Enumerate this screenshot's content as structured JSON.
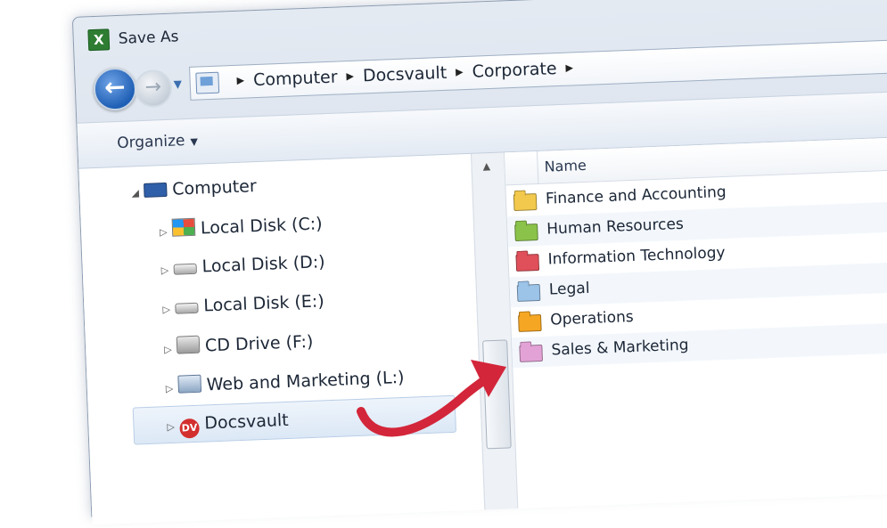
{
  "window": {
    "title": "Save As",
    "app_icon_letter": "X"
  },
  "address_bar": {
    "crumbs": [
      "Computer",
      "Docsvault",
      "Corporate"
    ]
  },
  "toolbar": {
    "organize_label": "Organize"
  },
  "navigation_pane": {
    "items": [
      {
        "label": "Computer",
        "icon": "computer-icon"
      },
      {
        "label": "Local Disk (C:)",
        "icon": "windows-drive-icon"
      },
      {
        "label": "Local Disk (D:)",
        "icon": "drive-icon"
      },
      {
        "label": "Local Disk (E:)",
        "icon": "drive-icon"
      },
      {
        "label": "CD Drive (F:)",
        "icon": "cd-drive-icon"
      },
      {
        "label": "Web and Marketing (L:)",
        "icon": "network-drive-icon"
      },
      {
        "label": "Docsvault",
        "icon": "docsvault-icon",
        "icon_text": "DV"
      }
    ]
  },
  "file_list": {
    "column_name": "Name",
    "folders": [
      {
        "label": "Finance and Accounting",
        "color": "#f2c94c"
      },
      {
        "label": "Human Resources",
        "color": "#8bc34a"
      },
      {
        "label": "Information Technology",
        "color": "#e0505a"
      },
      {
        "label": "Legal",
        "color": "#9cc3e8"
      },
      {
        "label": "Operations",
        "color": "#f5a623"
      },
      {
        "label": "Sales & Marketing",
        "color": "#e3a2d6"
      }
    ]
  },
  "colors": {
    "annotation_arrow": "#d3263a",
    "selection": "#dce8f6"
  }
}
